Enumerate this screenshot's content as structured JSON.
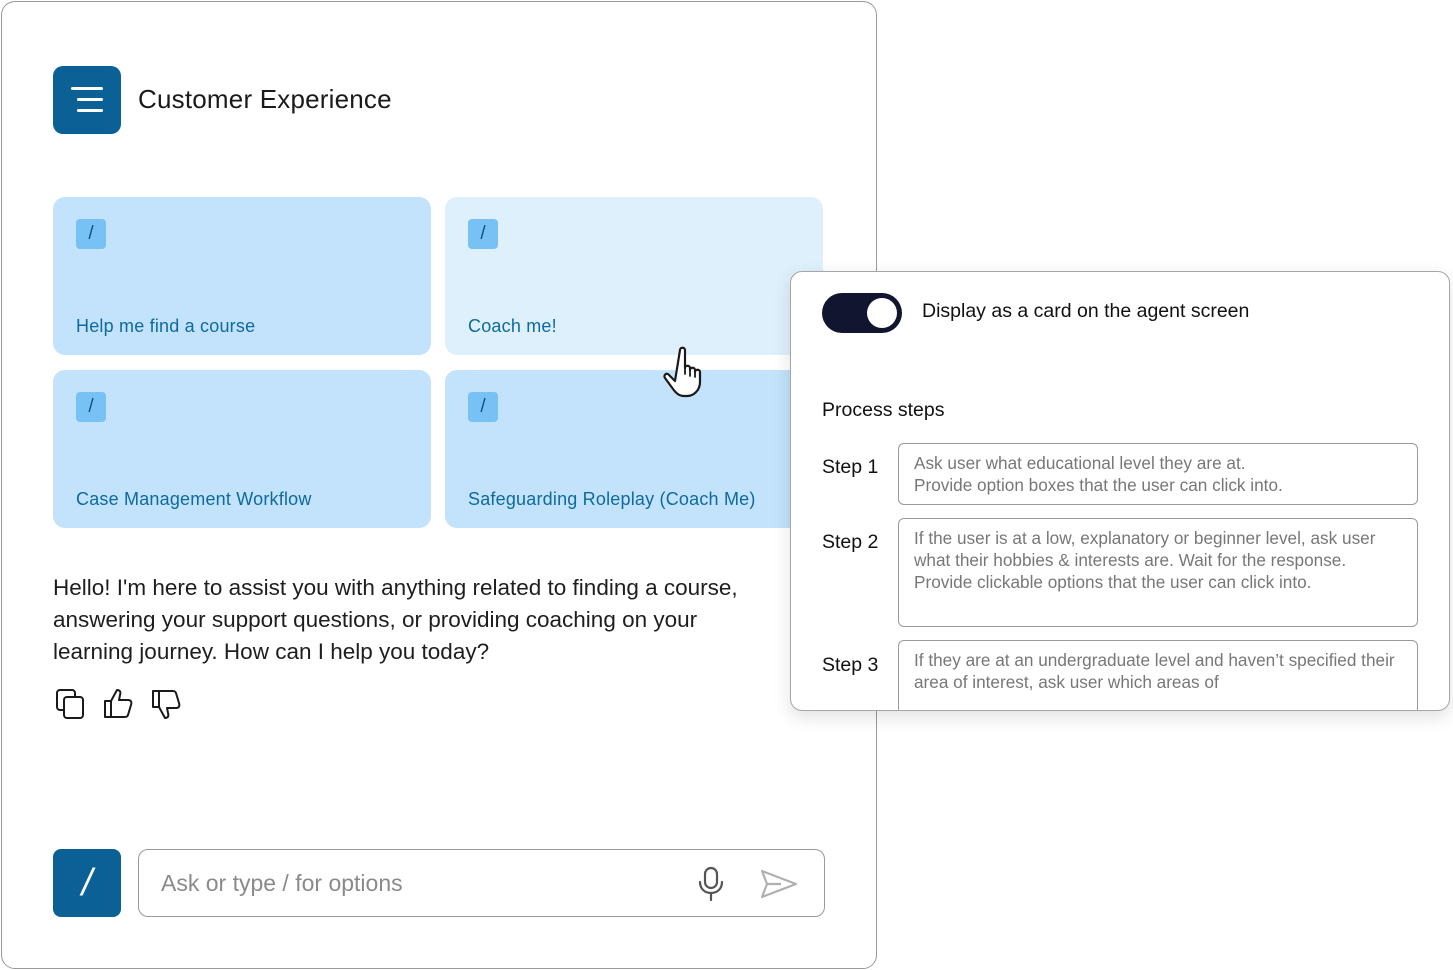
{
  "app": {
    "title": "Customer Experience",
    "menu_icon": "menu-icon"
  },
  "cards": [
    {
      "label": "Help me find a course",
      "badge": "/"
    },
    {
      "label": "Coach me!",
      "badge": "/"
    },
    {
      "label": "Case Management Workflow",
      "badge": "/"
    },
    {
      "label": "Safeguarding Roleplay (Coach Me)",
      "badge": "/"
    }
  ],
  "assistant": {
    "message": "Hello! I'm here to assist you with anything related to finding a course,\nanswering your support questions, or providing coaching on your\nlearning journey. How can I help you today?",
    "actions": [
      "copy-icon",
      "thumbs-up-icon",
      "thumbs-down-icon"
    ]
  },
  "composer": {
    "slash_label": "/",
    "placeholder": "Ask or type / for options",
    "mic_icon": "microphone-icon",
    "send_icon": "send-icon"
  },
  "settings": {
    "toggle_label": "Display as a card on the agent screen",
    "toggle_on": true,
    "section_title": "Process steps",
    "steps": [
      {
        "label": "Step 1",
        "text": "Ask user what educational level they are at.\nProvide option boxes that the user can click into."
      },
      {
        "label": "Step 2",
        "text": "If the user is at a low, explanatory or beginner level, ask user what their hobbies & interests are. Wait for the response. Provide clickable options that the user can click into."
      },
      {
        "label": "Step 3",
        "text": "If they are at an undergraduate level and haven’t specified their area of interest, ask user which areas of"
      }
    ]
  },
  "colors": {
    "brand": "#0b6196",
    "card_bg": "#c2e3fb",
    "card_bg_hover": "#dff0fd",
    "card_text": "#0e6a9f",
    "toggle_bg": "#121530"
  }
}
